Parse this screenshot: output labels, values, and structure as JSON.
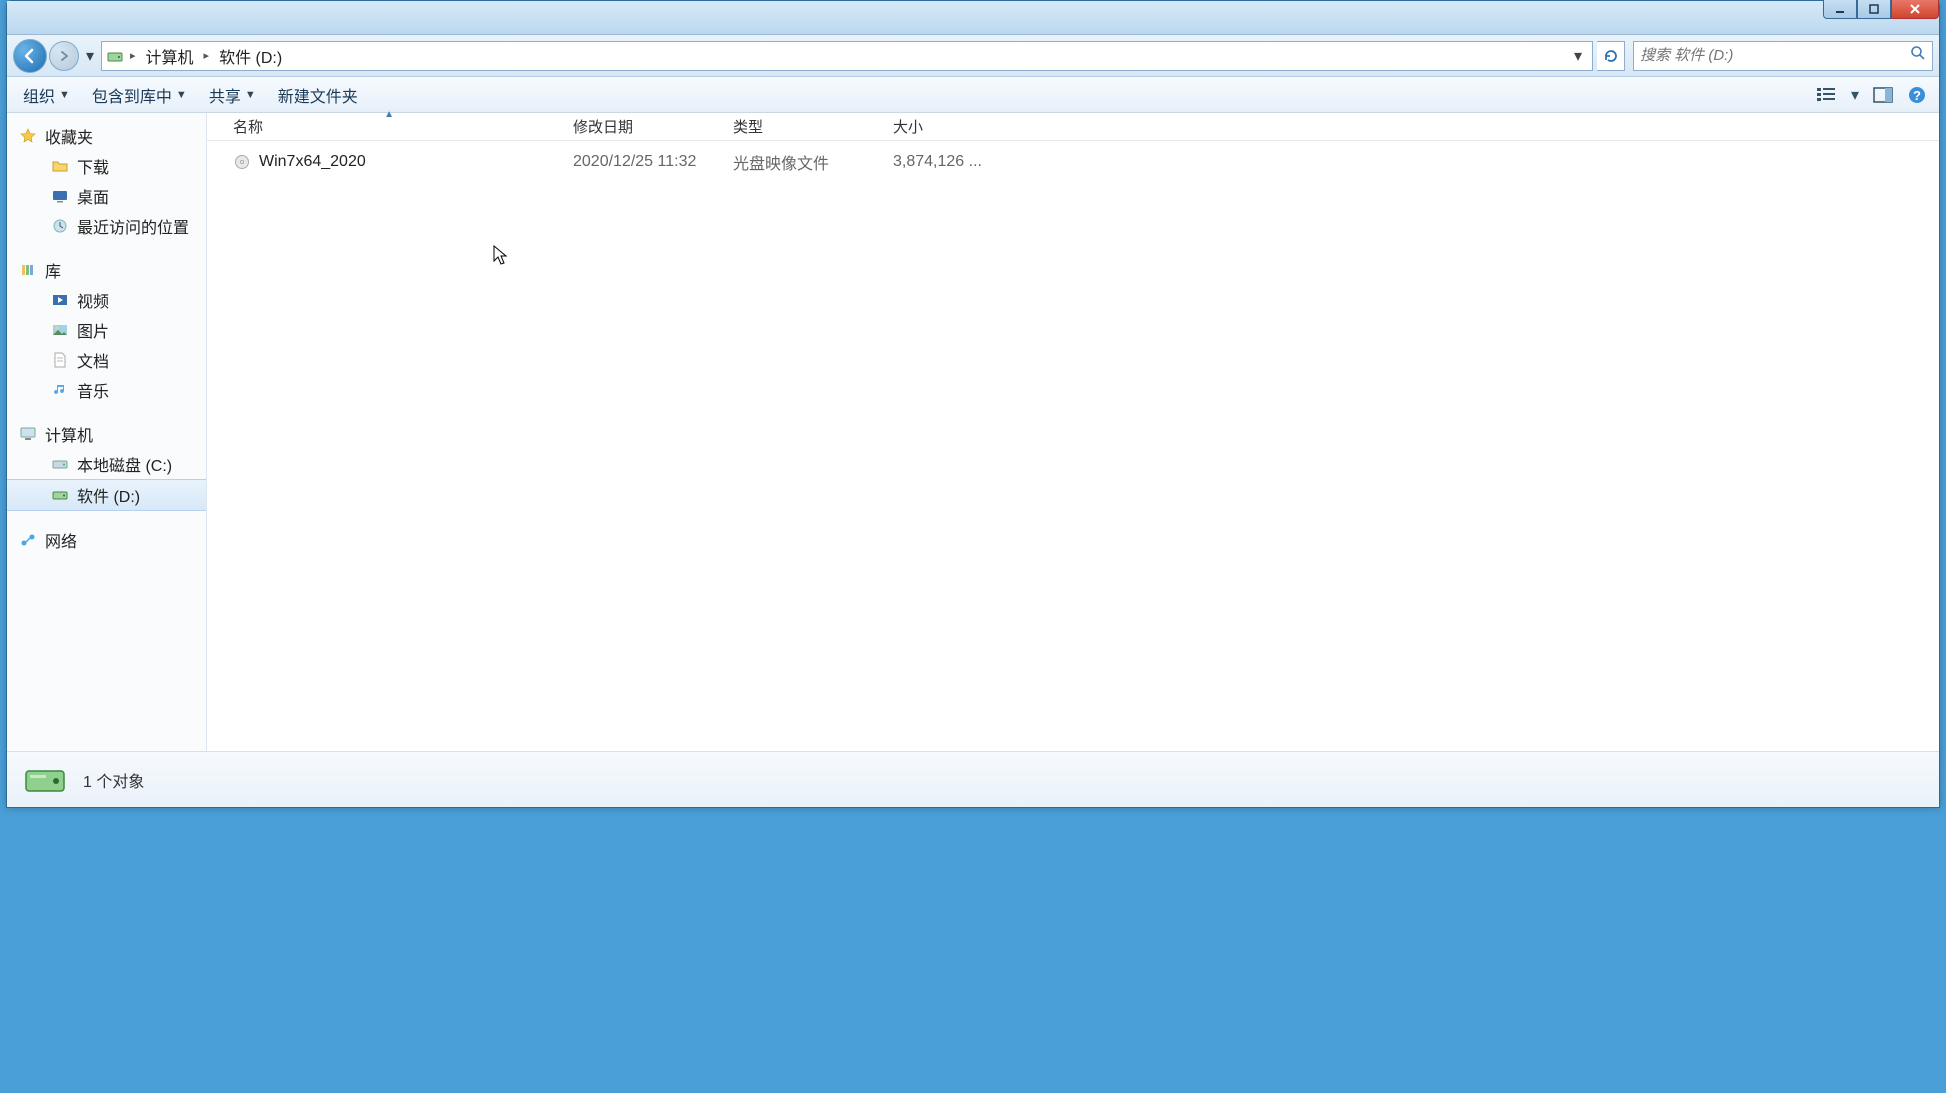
{
  "breadcrumb": {
    "seg0": "计算机",
    "seg1": "软件 (D:)"
  },
  "search": {
    "placeholder": "搜索 软件 (D:)"
  },
  "toolbar": {
    "organize": "组织",
    "include": "包含到库中",
    "share": "共享",
    "newfolder": "新建文件夹"
  },
  "sidebar": {
    "favorites": {
      "label": "收藏夹",
      "downloads": "下载",
      "desktop": "桌面",
      "recent": "最近访问的位置"
    },
    "libraries": {
      "label": "库",
      "videos": "视频",
      "pictures": "图片",
      "documents": "文档",
      "music": "音乐"
    },
    "computer": {
      "label": "计算机",
      "c": "本地磁盘 (C:)",
      "d": "软件 (D:)"
    },
    "network": {
      "label": "网络"
    }
  },
  "columns": {
    "name": "名称",
    "date": "修改日期",
    "type": "类型",
    "size": "大小"
  },
  "files": {
    "row0": {
      "name": "Win7x64_2020",
      "date": "2020/12/25 11:32",
      "type": "光盘映像文件",
      "size": "3,874,126 ..."
    }
  },
  "status": {
    "text": "1 个对象"
  }
}
